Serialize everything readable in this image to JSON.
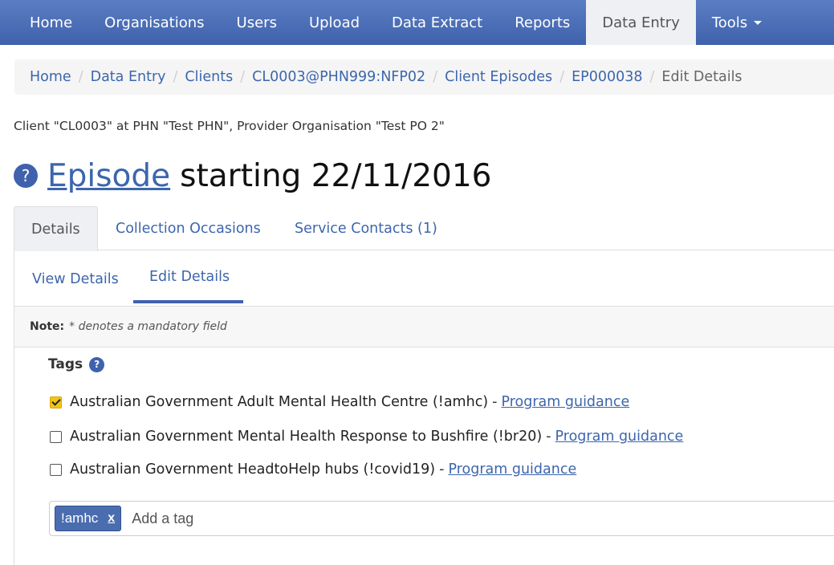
{
  "navbar": {
    "items": [
      {
        "label": "Home"
      },
      {
        "label": "Organisations"
      },
      {
        "label": "Users"
      },
      {
        "label": "Upload"
      },
      {
        "label": "Data Extract"
      },
      {
        "label": "Reports"
      },
      {
        "label": "Data Entry",
        "active": true
      },
      {
        "label": "Tools",
        "dropdown": true
      }
    ],
    "bg_color": "#4a6db5",
    "active_bg": "#eef0f3"
  },
  "breadcrumb": {
    "items": [
      "Home",
      "Data Entry",
      "Clients",
      "CL0003@PHN999:NFP02",
      "Client Episodes",
      "EP000038"
    ],
    "current": "Edit Details",
    "separator": "/"
  },
  "client_info": "Client \"CL0003\" at PHN \"Test PHN\", Provider Organisation \"Test PO 2\"",
  "title": {
    "help_icon": "?",
    "link": "Episode",
    "rest": "starting 22/11/2016"
  },
  "tabs": [
    {
      "label": "Details",
      "active": true
    },
    {
      "label": "Collection Occasions"
    },
    {
      "label": "Service Contacts (1)"
    }
  ],
  "subtabs": [
    {
      "label": "View Details"
    },
    {
      "label": "Edit Details",
      "active": true
    }
  ],
  "note": {
    "label": "Note:",
    "text": "* denotes a mandatory field"
  },
  "tags": {
    "label": "Tags",
    "help_icon": "?",
    "options": [
      {
        "label": "Australian Government Adult Mental Health Centre (!amhc)",
        "dash": "-",
        "link": "Program guidance",
        "checked": true
      },
      {
        "label": "Australian Government Mental Health Response to Bushfire (!br20)",
        "dash": "-",
        "link": "Program guidance",
        "checked": false
      },
      {
        "label": "Australian Government HeadtoHelp hubs (!covid19)",
        "dash": "-",
        "link": "Program guidance",
        "checked": false
      }
    ],
    "input": {
      "chips": [
        {
          "label": "!amhc",
          "remove": "x"
        }
      ],
      "placeholder": "Add a tag"
    }
  },
  "colors": {
    "link": "#3c66ad",
    "checkbox_checked": "#f0c419",
    "chip": "#4a6db0"
  }
}
